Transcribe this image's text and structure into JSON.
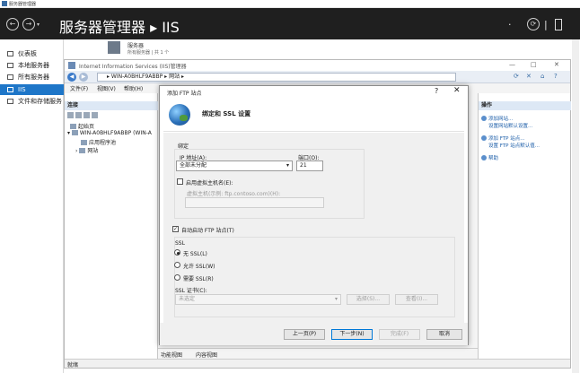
{
  "window_title": "服务器管理器",
  "header": {
    "breadcrumb": "服务器管理器 ▸ IIS",
    "back_icon": "arrow-left-icon",
    "refresh_icon": "refresh-icon",
    "flag_icon": "flag-icon"
  },
  "sidebar": {
    "items": [
      {
        "label": "仪表板"
      },
      {
        "label": "本地服务器"
      },
      {
        "label": "所有服务器"
      },
      {
        "label": "IIS"
      },
      {
        "label": "文件和存储服务"
      }
    ]
  },
  "servers_tile": {
    "title": "服务器",
    "subtitle": "所有服务器 | 共 1 个"
  },
  "iis": {
    "title": "Internet Information Services (IIS)管理器",
    "address": "▸ WIN-A0BHLF9ABBP ▸ 网站 ▸",
    "menu": [
      "文件(F)",
      "视图(V)",
      "帮助(H)"
    ],
    "connections_header": "连接",
    "tree": [
      "起始页",
      "WIN-A0BHLF9ABBP (WIN-A",
      "应用程序池",
      "网站"
    ],
    "actions_header": "操作",
    "actions": [
      "添加网站...",
      "设置网站默认设置...",
      "添加 FTP 站点...",
      "设置 FTP 站点默认值...",
      "帮助"
    ],
    "bottom_tabs": [
      "功能视图",
      "内容视图"
    ],
    "status": "就绪"
  },
  "dialog": {
    "title": "添加 FTP 站点",
    "help": "?",
    "close": "✕",
    "banner_title": "绑定和 SSL 设置",
    "binding_label": "绑定",
    "ip_label": "IP 地址(A):",
    "ip_value": "全部未分配",
    "port_label": "端口(O):",
    "port_value": "21",
    "vhost_checkbox": "启用虚拟主机名(E):",
    "vhost_label": "虚拟主机(示例: ftp.contoso.com)(H):",
    "vhost_value": "",
    "autostart_checkbox": "自动启动 FTP 站点(T)",
    "ssl_label": "SSL",
    "ssl_options": [
      "无 SSL(L)",
      "允许 SSL(W)",
      "需要 SSL(R)"
    ],
    "cert_label": "SSL 证书(C):",
    "cert_value": "未选定",
    "select_btn": "选择(S)...",
    "view_btn": "查看(I)...",
    "prev_btn": "上一页(P)",
    "next_btn": "下一步(N)",
    "finish_btn": "完成(F)",
    "cancel_btn": "取消"
  }
}
